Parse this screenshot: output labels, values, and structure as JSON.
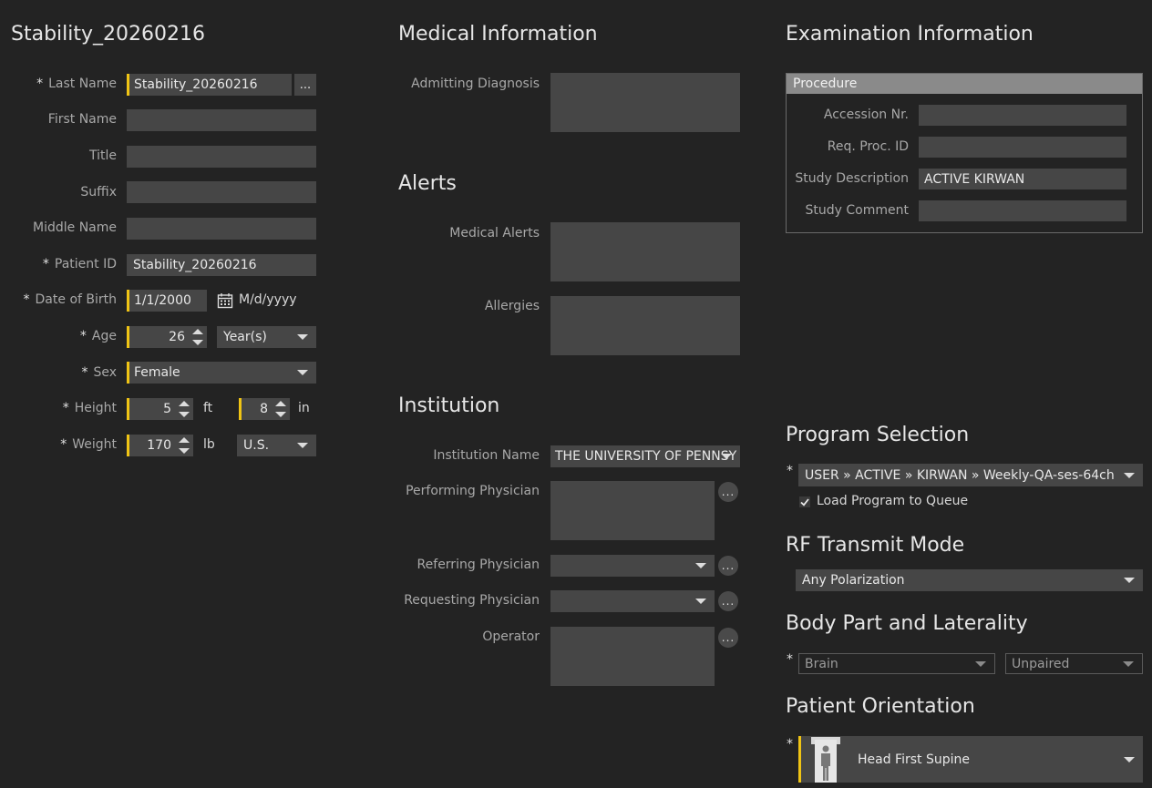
{
  "patient": {
    "heading": "Stability_20260216",
    "last_name_label": "Last Name",
    "last_name_value": "Stability_20260216",
    "more_button": "...",
    "first_name_label": "First Name",
    "title_label": "Title",
    "suffix_label": "Suffix",
    "middle_name_label": "Middle Name",
    "patient_id_label": "Patient ID",
    "patient_id_value": "Stability_20260216",
    "dob_label": "Date of Birth",
    "dob_value": "1/1/2000",
    "dob_format": "M/d/yyyy",
    "age_label": "Age",
    "age_value": "26",
    "age_unit": "Year(s)",
    "sex_label": "Sex",
    "sex_value": "Female",
    "height_label": "Height",
    "height_ft": "5",
    "height_ft_unit": "ft",
    "height_in": "8",
    "height_in_unit": "in",
    "weight_label": "Weight",
    "weight_value": "170",
    "weight_unit": "lb",
    "weight_system": "U.S.",
    "required_mark": "*"
  },
  "medical": {
    "heading": "Medical Information",
    "admitting_label": "Admitting Diagnosis",
    "alerts_heading": "Alerts",
    "medical_alerts_label": "Medical Alerts",
    "allergies_label": "Allergies"
  },
  "institution": {
    "heading": "Institution",
    "name_label": "Institution Name",
    "name_value": "THE UNIVERSITY OF PENNSY",
    "performing_label": "Performing Physician",
    "referring_label": "Referring Physician",
    "requesting_label": "Requesting Physician",
    "operator_label": "Operator",
    "dots": "..."
  },
  "exam": {
    "heading": "Examination Information",
    "procedure_header": "Procedure",
    "accession_label": "Accession Nr.",
    "req_proc_label": "Req. Proc. ID",
    "study_desc_label": "Study Description",
    "study_desc_value": "ACTIVE KIRWAN",
    "study_comment_label": "Study Comment"
  },
  "program": {
    "heading": "Program Selection",
    "path": "USER  »  ACTIVE  »  KIRWAN  »  Weekly-QA-ses-64ch",
    "load_queue_label": "Load Program to Queue",
    "load_queue_checked": true
  },
  "rf": {
    "heading": "RF Transmit Mode",
    "value": "Any Polarization"
  },
  "body_part": {
    "heading": "Body Part and Laterality",
    "part_value": "Brain",
    "laterality_value": "Unpaired"
  },
  "orientation": {
    "heading": "Patient Orientation",
    "value": "Head First Supine"
  },
  "colors": {
    "background": "#232323",
    "field": "#464646",
    "required_accent": "#f0c414",
    "group_header": "#8a8a8a"
  }
}
